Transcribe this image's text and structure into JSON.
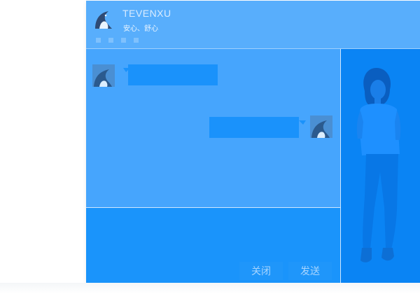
{
  "window": {
    "title": "TEVENXU",
    "subtitle": "安心、舒心"
  },
  "toolbar": {
    "icons": [
      "tool-icon",
      "tool-icon",
      "tool-icon",
      "tool-icon"
    ]
  },
  "chat": {
    "messages": [
      {
        "from": "contact",
        "text": ""
      },
      {
        "from": "self",
        "text": ""
      }
    ]
  },
  "input": {
    "value": ""
  },
  "buttons": {
    "close_label": "关闭",
    "send_label": "发送"
  },
  "colors": {
    "window_bg": "#1a94fb",
    "titlebar_bg": "#58aefc",
    "chat_bg": "#46a5fd",
    "side_panel_bg": "#0a84f4",
    "bubble_bg": "#1a92fb"
  }
}
